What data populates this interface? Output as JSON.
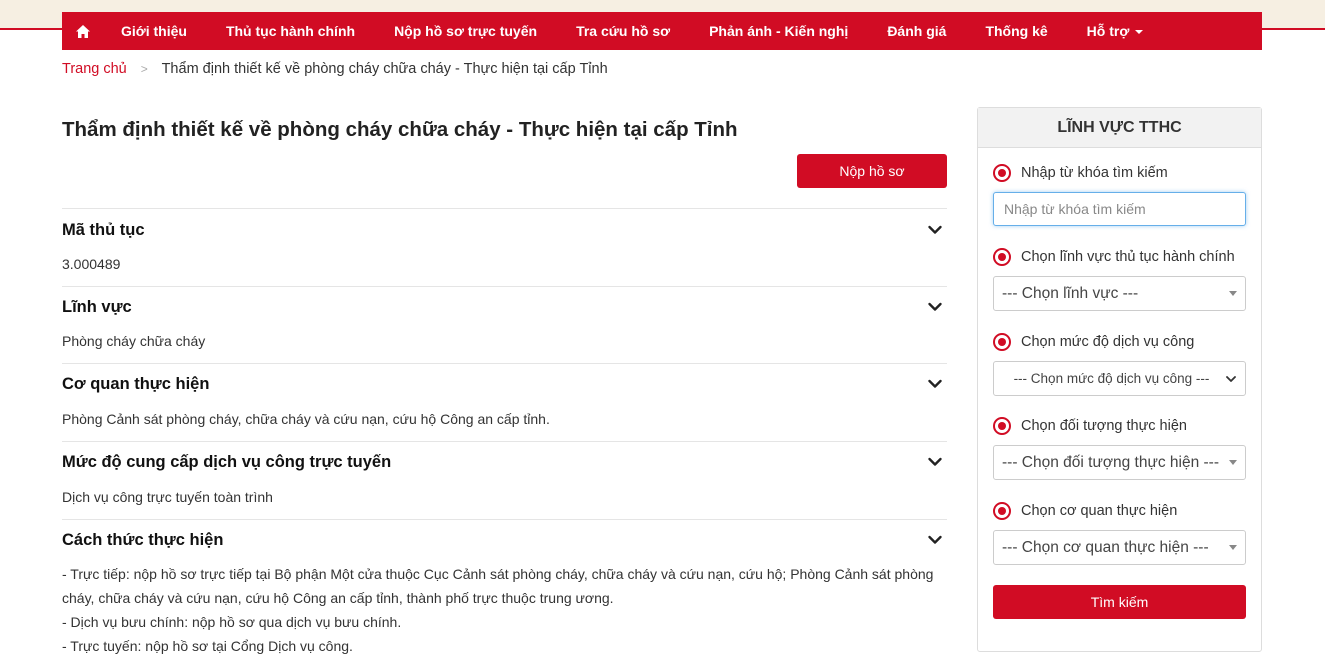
{
  "nav": {
    "home_icon": "home-icon",
    "items": [
      {
        "label": "Giới thiệu"
      },
      {
        "label": "Thủ tục hành chính"
      },
      {
        "label": "Nộp hồ sơ trực tuyến"
      },
      {
        "label": "Tra cứu hồ sơ"
      },
      {
        "label": "Phản ánh - Kiến nghị"
      },
      {
        "label": "Đánh giá"
      },
      {
        "label": "Thống kê"
      },
      {
        "label": "Hỗ trợ"
      }
    ],
    "accent_color": "#d10c24"
  },
  "breadcrumb": {
    "home": "Trang chủ",
    "separator": ">",
    "current": "Thẩm định thiết kế về phòng cháy chữa cháy - Thực hiện tại cấp Tỉnh"
  },
  "page": {
    "title": "Thẩm định thiết kế về phòng cháy chữa cháy - Thực hiện tại cấp Tỉnh",
    "submit_label": "Nộp hồ sơ"
  },
  "sections": [
    {
      "title": "Mã thủ tục",
      "content": [
        "3.000489"
      ]
    },
    {
      "title": "Lĩnh vực",
      "content": [
        "Phòng cháy chữa cháy"
      ]
    },
    {
      "title": "Cơ quan thực hiện",
      "content": [
        "Phòng Cảnh sát phòng cháy, chữa cháy và cứu nạn, cứu hộ Công an cấp tỉnh."
      ]
    },
    {
      "title": "Mức độ cung cấp dịch vụ công trực tuyến",
      "content": [
        "Dịch vụ công trực tuyến toàn trình"
      ]
    },
    {
      "title": "Cách thức thực hiện",
      "content": [
        "- Trực tiếp: nộp hồ sơ trực tiếp tại Bộ phận Một cửa thuộc Cục Cảnh sát phòng cháy, chữa cháy và cứu nạn, cứu hộ; Phòng Cảnh sát phòng cháy, chữa cháy và cứu nạn, cứu hộ Công an cấp tỉnh, thành phố trực thuộc trung ương.",
        "- Dịch vụ bưu chính: nộp hồ sơ qua dịch vụ bưu chính.",
        "- Trực tuyến: nộp hồ sơ tại Cổng Dịch vụ công."
      ]
    }
  ],
  "sidebar": {
    "title": "LĨNH VỰC TTHC",
    "keyword_label": "Nhập từ khóa tìm kiếm",
    "keyword_placeholder": "Nhập từ khóa tìm kiếm",
    "field_label": "Chọn lĩnh vực thủ tục hành chính",
    "field_value": "--- Chọn lĩnh vực ---",
    "level_label": "Chọn mức độ dịch vụ công",
    "level_value": "--- Chọn mức độ dịch vụ công ---",
    "target_label": "Chọn đối tượng thực hiện",
    "target_value": "--- Chọn đối tượng thực hiện ---",
    "agency_label": "Chọn cơ quan thực hiện",
    "agency_value": "--- Chọn cơ quan thực hiện ---",
    "search_label": "Tìm kiếm"
  }
}
